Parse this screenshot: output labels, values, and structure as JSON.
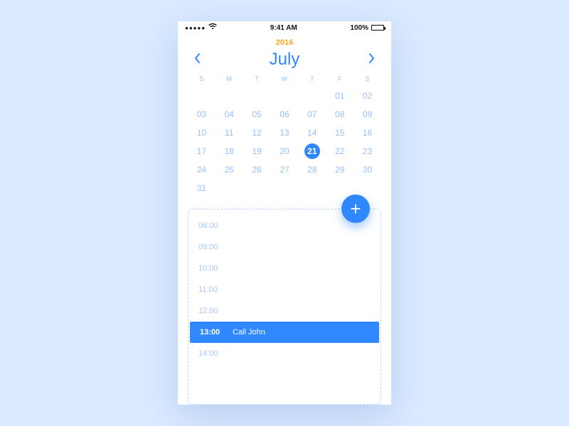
{
  "status": {
    "time": "9:41 AM",
    "battery_pct": "100%",
    "signal_dots": "●●●●●",
    "wifi_icon": "wifi"
  },
  "year": "2016",
  "month": {
    "label": "July",
    "prev_icon": "chevron-left",
    "next_icon": "chevron-right"
  },
  "weekdays": [
    "S",
    "M",
    "T",
    "W",
    "T",
    "F",
    "S"
  ],
  "calendar_rows": [
    [
      "",
      "",
      "",
      "",
      "",
      "01",
      "02"
    ],
    [
      "03",
      "04",
      "05",
      "06",
      "07",
      "08",
      "09"
    ],
    [
      "10",
      "11",
      "12",
      "13",
      "14",
      "15",
      "16"
    ],
    [
      "17",
      "18",
      "19",
      "20",
      "21",
      "22",
      "23"
    ],
    [
      "24",
      "25",
      "26",
      "27",
      "28",
      "29",
      "30"
    ],
    [
      "31",
      "",
      "",
      "",
      "",
      "",
      ""
    ]
  ],
  "selected_day": "21",
  "fab_icon": "+",
  "slots": [
    {
      "time": "08:00",
      "label": "",
      "event": false
    },
    {
      "time": "09:00",
      "label": "",
      "event": false
    },
    {
      "time": "10:00",
      "label": "",
      "event": false
    },
    {
      "time": "11:00",
      "label": "",
      "event": false
    },
    {
      "time": "12:00",
      "label": "",
      "event": false
    },
    {
      "time": "13:00",
      "label": "Call John",
      "event": true
    },
    {
      "time": "14:00",
      "label": "",
      "event": false
    }
  ],
  "colors": {
    "accent": "#2f88ff",
    "year": "#f5a623",
    "muted": "#96c1ff",
    "card_border": "#bcd6ff"
  }
}
